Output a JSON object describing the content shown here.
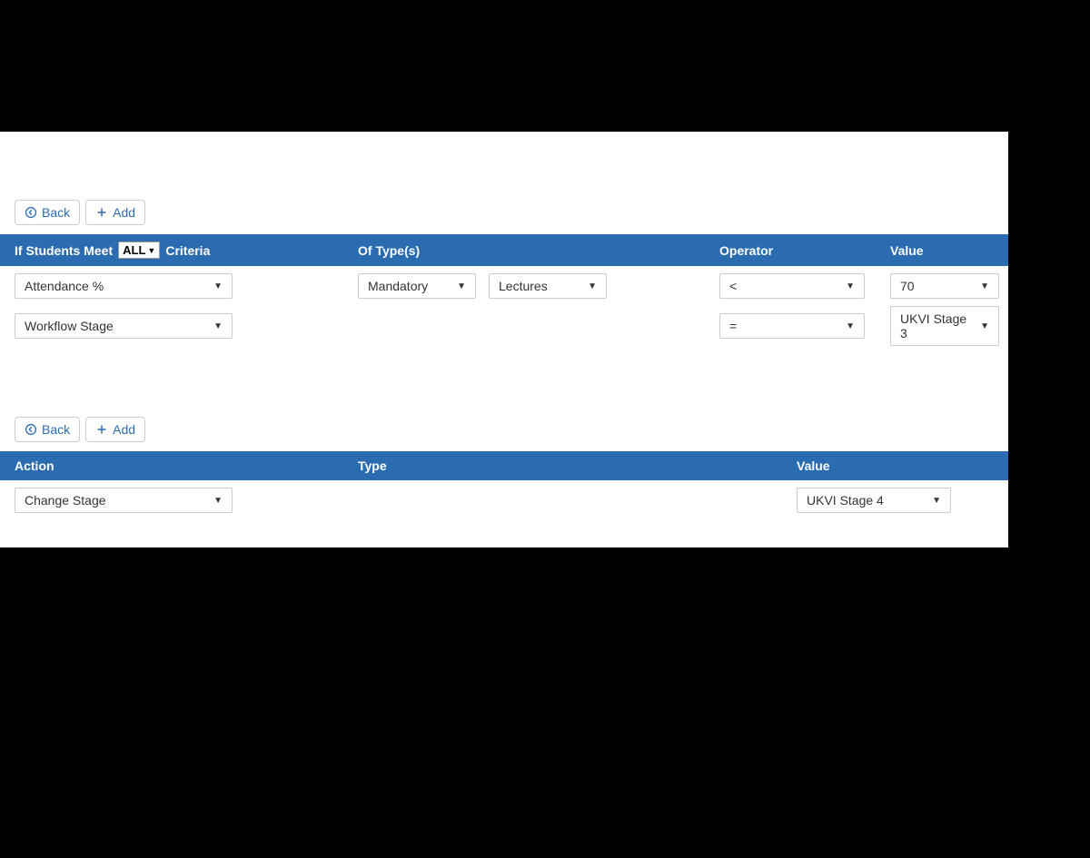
{
  "criteriaSection": {
    "toolbar": {
      "backLabel": "Back",
      "addLabel": "Add"
    },
    "header": {
      "prefix": "If Students Meet",
      "quantifier": "ALL",
      "suffix": "Criteria",
      "typeLabel": "Of Type(s)",
      "operatorLabel": "Operator",
      "valueLabel": "Value"
    },
    "rows": [
      {
        "criteria": "Attendance %",
        "type1": "Mandatory",
        "type2": "Lectures",
        "operator": "<",
        "value": "70"
      },
      {
        "criteria": "Workflow Stage",
        "type1": "",
        "type2": "",
        "operator": "=",
        "value": "UKVI Stage 3"
      }
    ]
  },
  "actionSection": {
    "toolbar": {
      "backLabel": "Back",
      "addLabel": "Add"
    },
    "header": {
      "actionLabel": "Action",
      "typeLabel": "Type",
      "valueLabel": "Value"
    },
    "rows": [
      {
        "action": "Change Stage",
        "type": "",
        "value": "UKVI Stage 4"
      }
    ]
  }
}
